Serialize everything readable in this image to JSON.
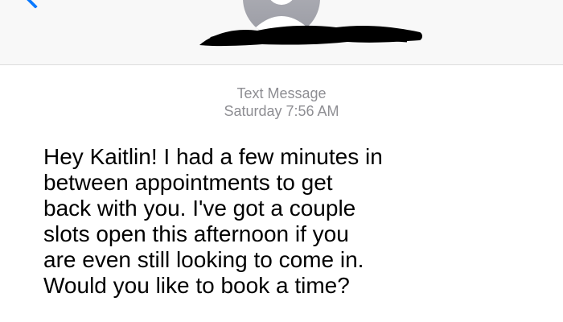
{
  "header": {
    "back_icon": "chevron-left-icon",
    "avatar_icon": "person-icon",
    "contact_name_redacted": true,
    "accent_color": "#0a7aff"
  },
  "thread": {
    "service_label": "Text Message",
    "timestamp": "Saturday 7:56 AM"
  },
  "messages": [
    {
      "direction": "incoming",
      "text": "Hey Kaitlin! I had a few minutes in\nbetween appointments to get\nback with you. I've got a couple\nslots open this afternoon if you\nare even still looking to come in.\nWould you like to book a time?"
    }
  ]
}
